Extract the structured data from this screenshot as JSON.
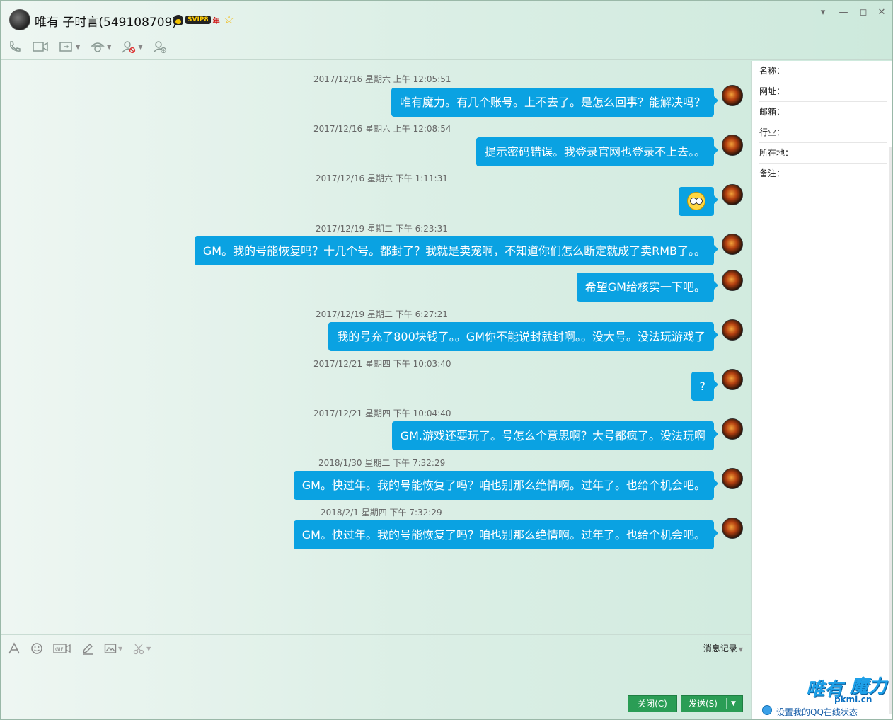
{
  "header": {
    "contact_name": "唯有 子时言(549108709)",
    "vip_label": "SVIP8",
    "vip_year": "年",
    "window_controls": [
      "chevron-down-icon",
      "minimize-icon",
      "maximize-icon",
      "close-icon"
    ]
  },
  "toolbar": {
    "items": [
      "phone-icon",
      "video-icon",
      "share-screen-icon",
      "remote-assist-icon",
      "block-user-icon",
      "add-friend-icon"
    ]
  },
  "messages": [
    {
      "timestamp": "2017/12/16 星期六 上午 12:05:51",
      "text": "唯有魔力。有几个账号。上不去了。是怎么回事？能解决吗？"
    },
    {
      "timestamp": "2017/12/16 星期六 上午 12:08:54",
      "text": "提示密码错误。我登录官网也登录不上去。。"
    },
    {
      "timestamp": "2017/12/16 星期六 下午 1:11:31",
      "text": "",
      "emoji": "shocked-face-emoji"
    },
    {
      "timestamp": "2017/12/19 星期二 下午 6:23:31",
      "text": "GM。我的号能恢复吗？十几个号。都封了？我就是卖宠啊，不知道你们怎么断定就成了卖RMB了。。"
    },
    {
      "timestamp": "",
      "text": "希望GM给核实一下吧。"
    },
    {
      "timestamp": "2017/12/19 星期二 下午 6:27:21",
      "text": "我的号充了800块钱了。。GM你不能说封就封啊。。没大号。没法玩游戏了"
    },
    {
      "timestamp": "2017/12/21 星期四 下午 10:03:40",
      "text": "?"
    },
    {
      "timestamp": "2017/12/21 星期四 下午 10:04:40",
      "text": "GM.游戏还要玩了。号怎么个意思啊？大号都疯了。没法玩啊"
    },
    {
      "timestamp": "2018/1/30 星期二 下午 7:32:29",
      "text": "GM。快过年。我的号能恢复了吗？咱也别那么绝情啊。过年了。也给个机会吧。"
    },
    {
      "timestamp": "2018/2/1 星期四 下午 7:32:29",
      "text": "GM。快过年。我的号能恢复了吗？咱也别那么绝情啊。过年了。也给个机会吧。"
    }
  ],
  "input": {
    "tools": [
      "font-icon",
      "emoji-icon",
      "gif-icon",
      "handwriting-icon",
      "image-icon",
      "screenshot-icon"
    ],
    "history_label": "消息记录",
    "close_label": "关闭(C)",
    "send_label": "发送(S)"
  },
  "profile": {
    "fields": [
      "名称：",
      "网址：",
      "邮箱：",
      "行业：",
      "所在地：",
      "备注："
    ]
  },
  "footer": {
    "status_link": "设置我的QQ在线状态",
    "logo_text_1": "唯有",
    "logo_text_2": "魔力",
    "logo_url": "pkml.cn"
  },
  "colors": {
    "bubble": "#0aa2e2",
    "button_green": "#2a9d55",
    "background_tint": "#d5ece1"
  }
}
